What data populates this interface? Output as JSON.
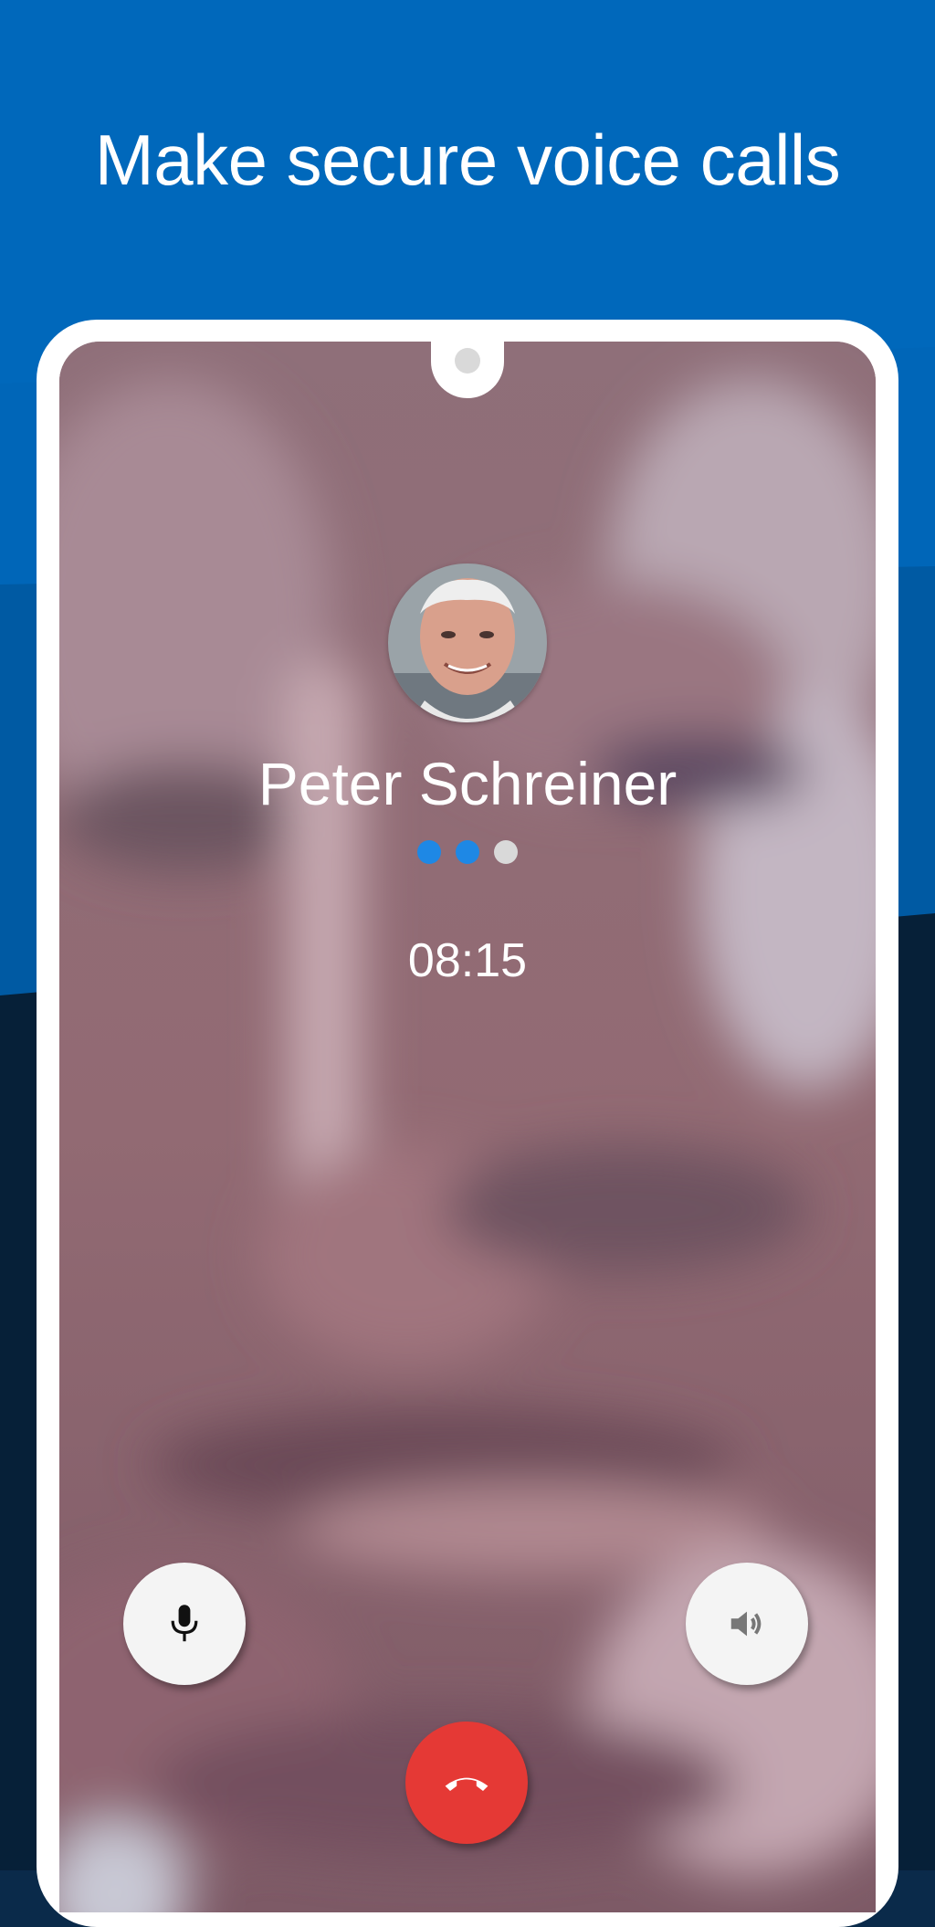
{
  "headline": "Make secure voice calls",
  "call": {
    "caller_name": "Peter Schreiner",
    "timer": "08:15",
    "status_dots": [
      {
        "state": "active",
        "color": "#1e88e5"
      },
      {
        "state": "active",
        "color": "#1e88e5"
      },
      {
        "state": "inactive",
        "color": "#d9d9d9"
      }
    ]
  },
  "icons": {
    "mute": "microphone-icon",
    "speaker": "speaker-icon",
    "hangup": "phone-hangup-icon"
  },
  "colors": {
    "background_blue": "#0066b8",
    "background_dark": "#072440",
    "hangup_red": "#e53935",
    "accent_blue": "#1e88e5"
  }
}
